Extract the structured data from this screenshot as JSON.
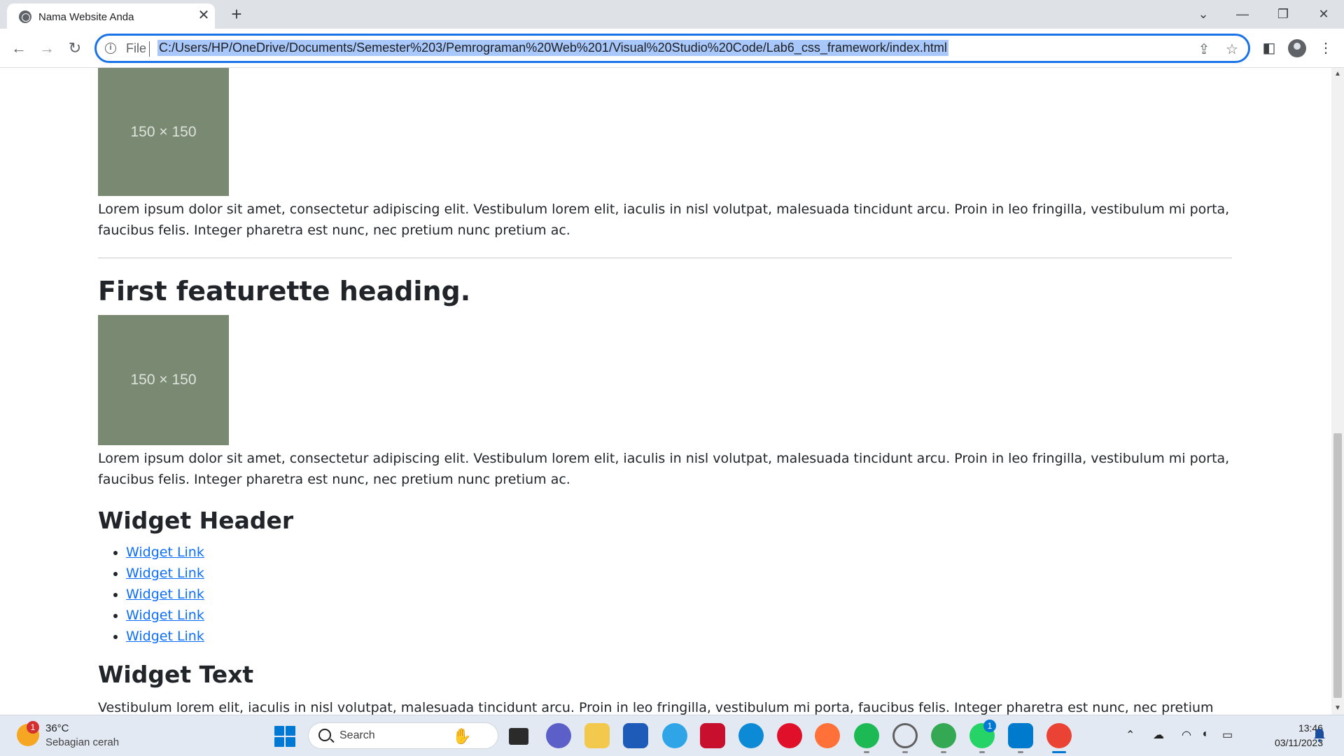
{
  "tab": {
    "title": "Nama Website Anda",
    "close": "✕",
    "new_tab": "+"
  },
  "window": {
    "dropdown": "⌄",
    "minimize": "—",
    "restore": "❐",
    "close": "✕"
  },
  "toolbar": {
    "back": "←",
    "forward": "→",
    "reload": "↻",
    "scheme": "File",
    "url": "C:/Users/HP/OneDrive/Documents/Semester%203/Pemrograman%20Web%201/Visual%20Studio%20Code/Lab6_css_framework/index.html",
    "share": "⇪",
    "bookmark": "☆",
    "sidepanel": "◧",
    "menu": "⋮"
  },
  "page": {
    "placeholder_label": "150 × 150",
    "paragraph_1": "Lorem ipsum dolor sit amet, consectetur adipiscing elit. Vestibulum lorem elit, iaculis in nisl volutpat, malesuada tincidunt arcu. Proin in leo fringilla, vestibulum mi porta, faucibus felis. Integer pharetra est nunc, nec pretium nunc pretium ac.",
    "featurette_heading": "First featurette heading.",
    "paragraph_2": "Lorem ipsum dolor sit amet, consectetur adipiscing elit. Vestibulum lorem elit, iaculis in nisl volutpat, malesuada tincidunt arcu. Proin in leo fringilla, vestibulum mi porta, faucibus felis. Integer pharetra est nunc, nec pretium nunc pretium ac.",
    "widget_header": "Widget Header",
    "widget_links": [
      "Widget Link",
      "Widget Link",
      "Widget Link",
      "Widget Link",
      "Widget Link"
    ],
    "widget_text_heading": "Widget Text",
    "widget_text": "Vestibulum lorem elit, iaculis in nisl volutpat, malesuada tincidunt arcu. Proin in leo fringilla, vestibulum mi porta, faucibus felis. Integer pharetra est nunc, nec pretium nunc pretium ac."
  },
  "taskbar": {
    "weather_badge": "1",
    "weather_temp": "36°C",
    "weather_desc": "Sebagian cerah",
    "search_label": "Search",
    "whatsapp_badge": "1",
    "time": "13:46",
    "date": "03/11/2023",
    "apps": [
      "file-explorer-taskview",
      "teams",
      "folder",
      "store",
      "edge-preview",
      "mcafee",
      "edge",
      "opera",
      "firefox",
      "spotify",
      "wifi-app",
      "chrome-profile",
      "whatsapp",
      "vscode",
      "chrome"
    ]
  },
  "colors": {
    "accent": "#1a73e8",
    "placeholder_bg": "#7a8a72",
    "link": "#0d6efd"
  }
}
